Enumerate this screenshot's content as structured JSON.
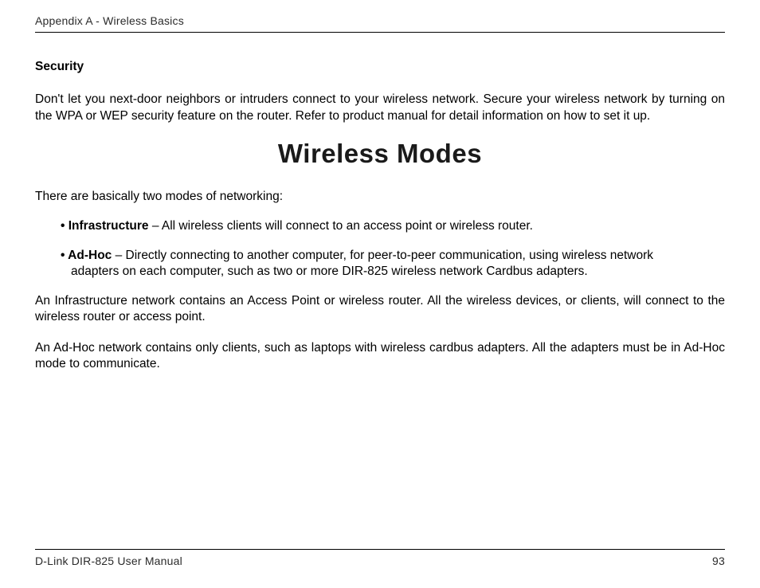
{
  "header": {
    "text": "Appendix A - Wireless Basics"
  },
  "security": {
    "heading": "Security",
    "paragraph": "Don't let you next-door neighbors or intruders connect to your wireless network. Secure your wireless network by turning on the WPA or WEP security feature on the router. Refer to product manual for detail information on how to set it up."
  },
  "title": "Wireless Modes",
  "intro": "There are basically two modes of networking:",
  "bullets": [
    {
      "label": "Infrastructure",
      "text": " – All wireless clients will connect to an access point or wireless router."
    },
    {
      "label": "Ad-Hoc",
      "text_line1": " – Directly connecting to another computer, for peer-to-peer communication, using wireless network",
      "text_line2": "adapters on each computer, such as two or more DIR-825 wireless network Cardbus adapters."
    }
  ],
  "paragraphs": [
    "An Infrastructure network contains an Access Point or wireless router. All the wireless devices, or clients, will connect to the wireless router or access point.",
    "An Ad-Hoc network contains only clients, such as laptops with wireless cardbus adapters. All the adapters must be in Ad-Hoc mode to communicate."
  ],
  "footer": {
    "left": "D-Link DIR-825 User Manual",
    "right": "93"
  }
}
